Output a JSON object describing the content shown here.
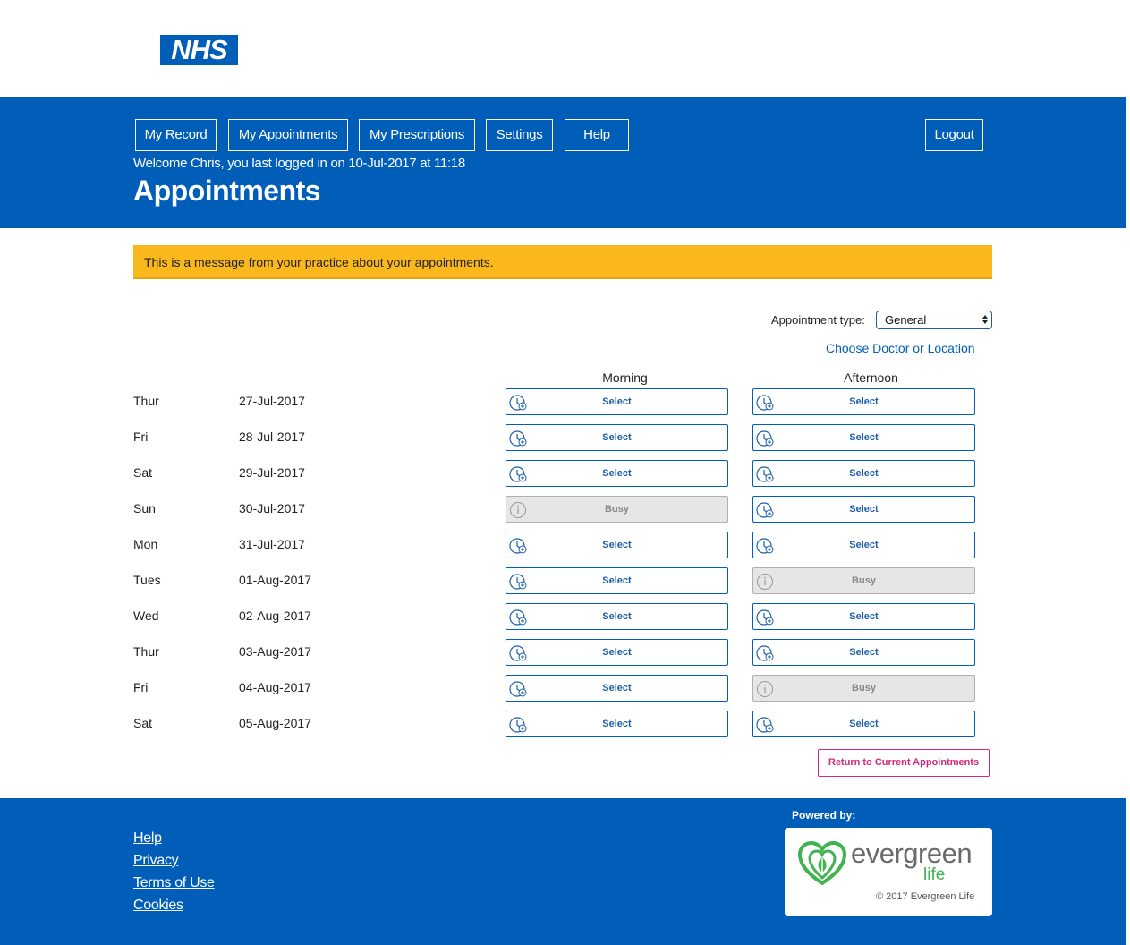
{
  "logo": {
    "text": "NHS"
  },
  "nav": {
    "my_record": "My Record",
    "my_appointments": "My Appointments",
    "my_prescriptions": "My Prescriptions",
    "settings": "Settings",
    "help": "Help",
    "logout": "Logout"
  },
  "welcome": "Welcome Chris, you last logged in on 10-Jul-2017 at 11:18",
  "page_title": "Appointments",
  "message": "This is a message from your practice about your appointments.",
  "filters": {
    "type_label": "Appointment type:",
    "type_value": "General",
    "choose_link": "Choose Doctor or Location"
  },
  "columns": {
    "morning": "Morning",
    "afternoon": "Afternoon"
  },
  "rows": [
    {
      "day": "Thur",
      "date": "27-Jul-2017",
      "morning": "Select",
      "afternoon": "Select"
    },
    {
      "day": "Fri",
      "date": "28-Jul-2017",
      "morning": "Select",
      "afternoon": "Select"
    },
    {
      "day": "Sat",
      "date": "29-Jul-2017",
      "morning": "Select",
      "afternoon": "Select"
    },
    {
      "day": "Sun",
      "date": "30-Jul-2017",
      "morning": "Busy",
      "afternoon": "Select"
    },
    {
      "day": "Mon",
      "date": "31-Jul-2017",
      "morning": "Select",
      "afternoon": "Select"
    },
    {
      "day": "Tues",
      "date": "01-Aug-2017",
      "morning": "Select",
      "afternoon": "Busy"
    },
    {
      "day": "Wed",
      "date": "02-Aug-2017",
      "morning": "Select",
      "afternoon": "Select"
    },
    {
      "day": "Thur",
      "date": "03-Aug-2017",
      "morning": "Select",
      "afternoon": "Select"
    },
    {
      "day": "Fri",
      "date": "04-Aug-2017",
      "morning": "Select",
      "afternoon": "Busy"
    },
    {
      "day": "Sat",
      "date": "05-Aug-2017",
      "morning": "Select",
      "afternoon": "Select"
    }
  ],
  "return_button": "Return to Current Appointments",
  "footer": {
    "links": [
      "Help",
      "Privacy",
      "Terms of Use",
      "Cookies"
    ],
    "powered_by": "Powered by:",
    "brand_word": "evergreen",
    "brand_life": "life",
    "copyright": "© 2017 Evergreen Life"
  },
  "colors": {
    "nhs_blue": "#005EB8",
    "message_bg": "#FBB81C",
    "return_pink": "#d4287a",
    "brand_green": "#3fb34f"
  },
  "icons": {
    "slot_select": "clock-add-icon",
    "slot_busy": "info-icon"
  }
}
